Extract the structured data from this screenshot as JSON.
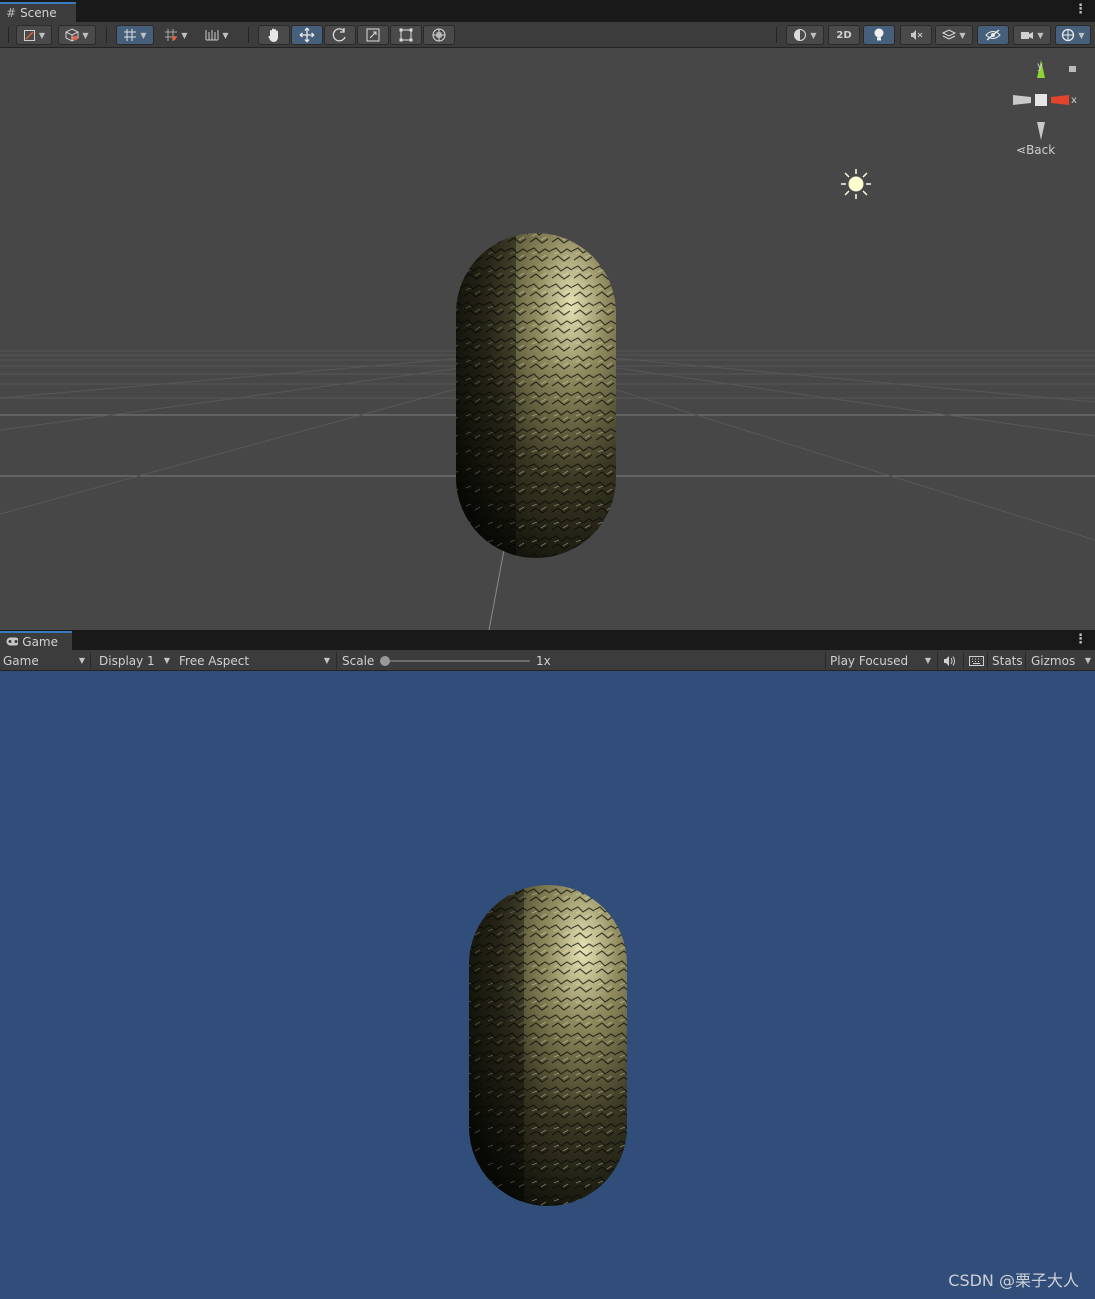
{
  "scene_tab": {
    "label": "Scene",
    "icon": "grid-hash-icon"
  },
  "scene_toolbar": {
    "left_tools": [
      "draw-mode-icon",
      "shading-cube-icon",
      "grid-snap-icon",
      "increment-snap-icon",
      "ruler-icon"
    ],
    "transform_tools": [
      "hand-tool-icon",
      "move-tool-icon",
      "rotate-tool-icon",
      "scale-tool-icon",
      "rect-tool-icon",
      "transform-tool-icon"
    ],
    "active_transform_tool": "move-tool-icon",
    "right_tools": [
      "shading-mode-icon",
      "2d-toggle",
      "lighting-toggle-icon",
      "audio-toggle-icon",
      "effects-icon",
      "hidden-objects-icon",
      "camera-icon",
      "gizmos-icon"
    ],
    "twod_label": "2D"
  },
  "orientation_gizmo": {
    "y_label": "y",
    "x_label": "x",
    "view_label": "Back",
    "colors": {
      "y": "#8ed433",
      "x": "#e2452c",
      "neutral": "#c8c8c8"
    }
  },
  "game_tab": {
    "label": "Game",
    "icon": "gamepad-icon"
  },
  "game_toolbar": {
    "mode_select": "Game",
    "display_select": "Display 1",
    "aspect_select": "Free Aspect",
    "scale_label": "Scale",
    "scale_value": "1x",
    "scale_fraction": 0.0,
    "play_mode_select": "Play Focused",
    "stats_label": "Stats",
    "gizmos_label": "Gizmos",
    "mute_icon": "speaker-icon",
    "keyboard_icon": "keyboard-icon"
  },
  "colors": {
    "scene_background": "#474747",
    "game_background": "#314d79",
    "accent_active": "#46607c",
    "capsule_highlight": "#dcd7a6"
  },
  "watermark": "CSDN @栗子大人"
}
